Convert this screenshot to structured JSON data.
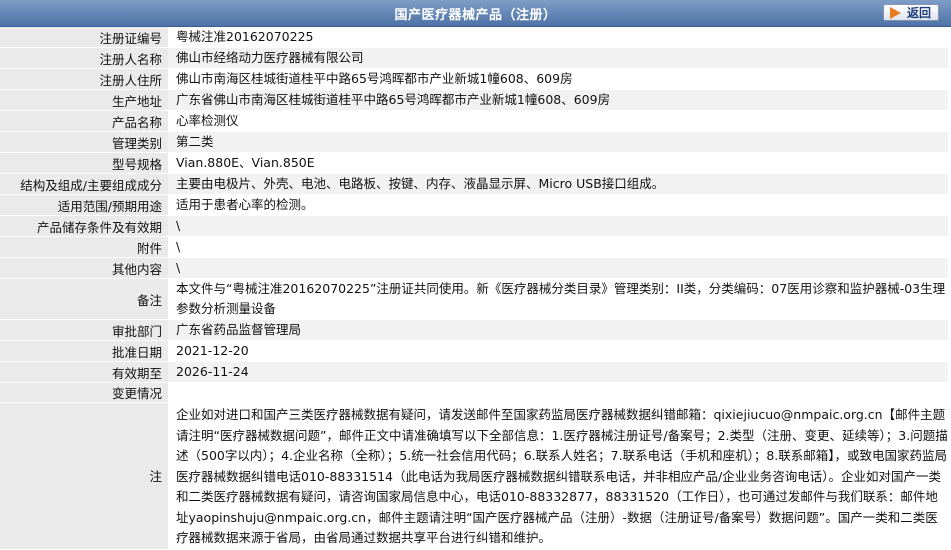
{
  "header": {
    "title": "国产医疗器械产品（注册）",
    "back_label": "返回"
  },
  "rows": [
    {
      "label": "注册证编号",
      "value": "粤械注准20162070225"
    },
    {
      "label": "注册人名称",
      "value": "佛山市经络动力医疗器械有限公司"
    },
    {
      "label": "注册人住所",
      "value": "佛山市南海区桂城街道桂平中路65号鸿晖都市产业新城1幢608、609房"
    },
    {
      "label": "生产地址",
      "value": "广东省佛山市南海区桂城街道桂平中路65号鸿晖都市产业新城1幢608、609房"
    },
    {
      "label": "产品名称",
      "value": "心率检测仪"
    },
    {
      "label": "管理类别",
      "value": "第二类"
    },
    {
      "label": "型号规格",
      "value": "Vian.880E、Vian.850E"
    },
    {
      "label": "结构及组成/主要组成成分",
      "value": "主要由电极片、外壳、电池、电路板、按键、内存、液晶显示屏、Micro USB接口组成。"
    },
    {
      "label": "适用范围/预期用途",
      "value": "适用于患者心率的检测。"
    },
    {
      "label": "产品储存条件及有效期",
      "value": "\\"
    },
    {
      "label": "附件",
      "value": "\\"
    },
    {
      "label": "其他内容",
      "value": "\\"
    },
    {
      "label": "备注",
      "value": "本文件与“粤械注准20162070225”注册证共同使用。新《医疗器械分类目录》管理类别：II类，分类编码：07医用诊察和监护器械-03生理参数分析测量设备"
    },
    {
      "label": "审批部门",
      "value": "广东省药品监督管理局"
    },
    {
      "label": "批准日期",
      "value": "2021-12-20"
    },
    {
      "label": "有效期至",
      "value": "2026-11-24"
    },
    {
      "label": "变更情况",
      "value": ""
    }
  ],
  "note": {
    "label": "注",
    "text": "企业如对进口和国产三类医疗器械数据有疑问，请发送邮件至国家药监局医疗器械数据纠错邮箱：qixiejiucuo@nmpaic.org.cn【邮件主题请注明“医疗器械数据问题”，邮件正文中请准确填写以下全部信息：1.医疗器械注册证号/备案号；2.类型（注册、变更、延续等）；3.问题描述（500字以内）；4.企业名称（全称）；5.统一社会信用代码；6.联系人姓名；7.联系电话（手机和座机）；8.联系邮箱】，或致电国家药监局医疗器械数据纠错电话010-88331514（此电话为我局医疗器械数据纠错联系电话，并非相应产品/企业业务咨询电话）。企业如对国产一类和二类医疗器械数据有疑问，请咨询国家局信息中心，电话010-88332877，88331520（工作日），也可通过发邮件与我们联系：邮件地址yaopinshuju@nmpaic.org.cn，邮件主题请注明“国产医疗器械产品（注册）-数据（注册证号/备案号）数据问题”。国产一类和二类医疗器械数据来源于省局，由省局通过数据共享平台进行纠错和维护。"
  },
  "colors": {
    "header_bg": "#4e72a7",
    "label_bg": "#eaeaea",
    "shade_bg": "#f2f2f2"
  }
}
